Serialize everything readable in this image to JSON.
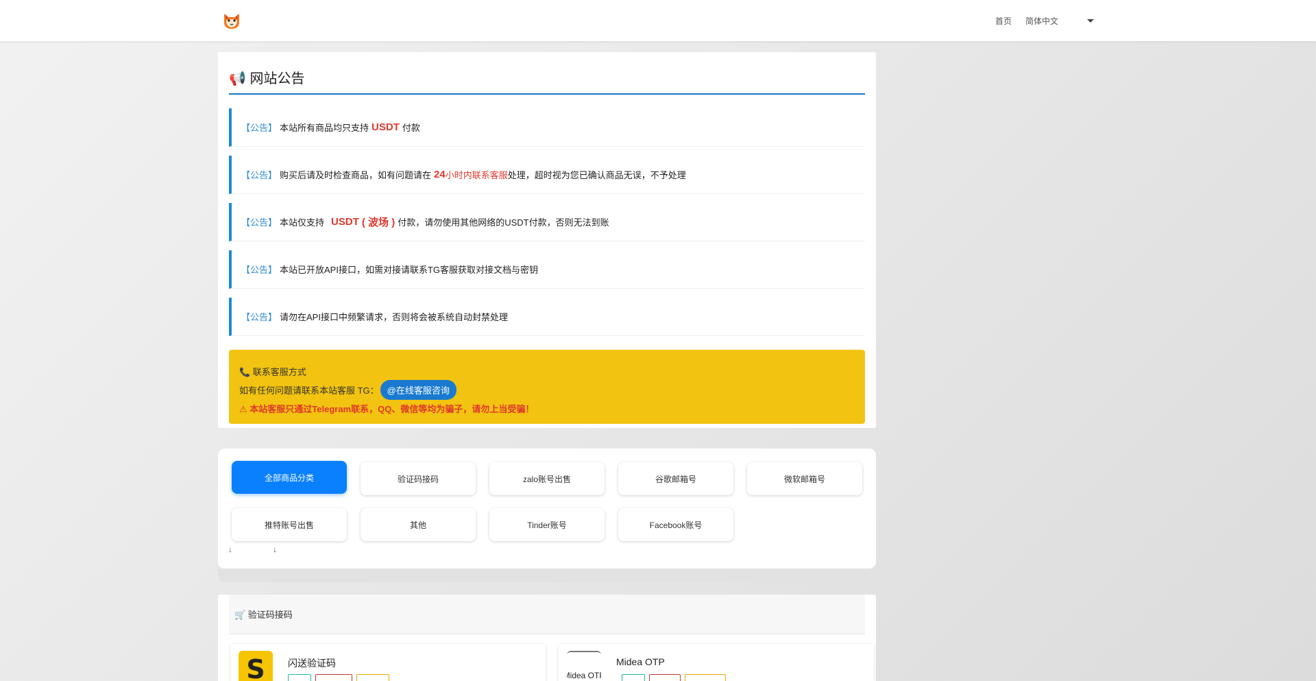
{
  "header": {
    "home_label": "首页",
    "lang_label": "简体中文"
  },
  "notice": {
    "title": "📢 网站公告",
    "items": [
      {
        "tag": "【公告】",
        "pre": "本站所有商品均只支持",
        "highlight": "USDT",
        "post": "付款"
      },
      {
        "tag": "【公告】",
        "pre": "购买后请及时检查商品，如有问题请在",
        "highlight": "24",
        "highlight2": "小时内联系客服",
        "post": "处理，超时视为您已确认商品无误，不予处理"
      },
      {
        "tag": "【公告】",
        "pre": "本站仅支持",
        "highlight": "USDT",
        "highlight2": "( 波场 )",
        "post": "付款，请勿使用其他网络的USDT付款，否则无法到账"
      },
      {
        "tag": "【公告】",
        "pre": "本站已开放API接口，如需对接请联系TG客服获取对接文档与密钥",
        "highlight": "",
        "post": ""
      },
      {
        "tag": "【公告】",
        "pre": "请勿在API接口中频繁请求，否则将会被系统自动封禁处理",
        "highlight": "",
        "post": ""
      }
    ]
  },
  "contact": {
    "title": "📞 联系客服方式",
    "line1": "如有任何问题请联系本站客服 TG：",
    "tg_handle": "@在线客服咨询",
    "warning": "⚠ 本站客服只通过Telegram联系，QQ、微信等均为骗子，请勿上当受骗！"
  },
  "categories": {
    "items": [
      {
        "label": "全部商品分类",
        "active": true
      },
      {
        "label": "验证码接码",
        "active": false
      },
      {
        "label": "zalo账号出售",
        "active": false
      },
      {
        "label": "谷歌邮箱号",
        "active": false
      },
      {
        "label": "微软邮箱号",
        "active": false
      },
      {
        "label": "推特账号出售",
        "active": false
      },
      {
        "label": "其他",
        "active": false
      },
      {
        "label": "Tinder账号",
        "active": false
      },
      {
        "label": "Facebook账号",
        "active": false
      }
    ],
    "arrow_left": "↓",
    "arrow_right": "↓"
  },
  "products": {
    "header": "🛒 验证码接码",
    "items": [
      {
        "name": "闪送验证码",
        "thumb_text": "S"
      },
      {
        "name": "Midea OTP",
        "thumb_text": "Midea OTP"
      }
    ]
  },
  "colors": {
    "accent": "#0a80ff",
    "notice_border": "#1a8ad8",
    "highlight_red": "#e0382c",
    "contact_bg": "#f2c310"
  }
}
